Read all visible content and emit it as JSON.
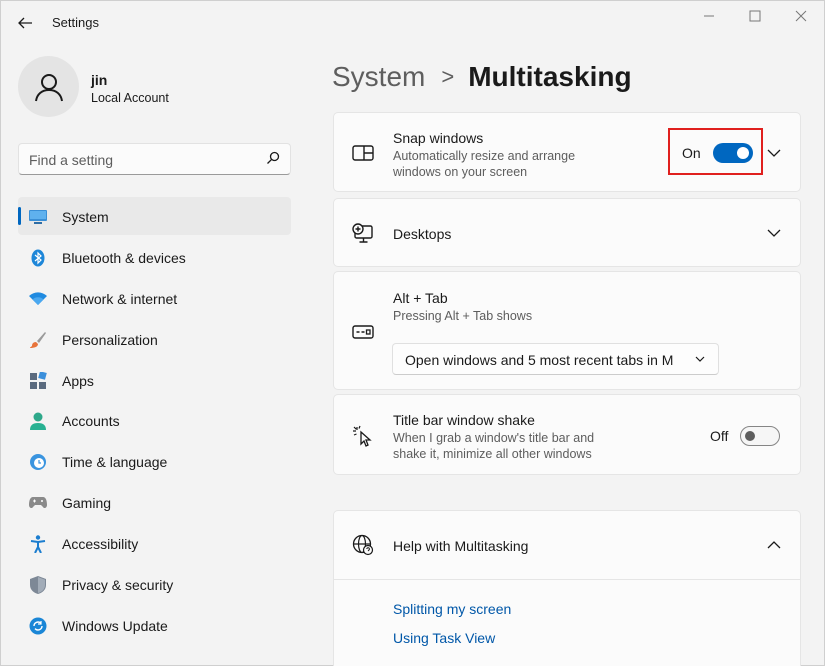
{
  "window": {
    "title": "Settings"
  },
  "profile": {
    "name": "jin",
    "account_type": "Local Account"
  },
  "search": {
    "placeholder": "Find a setting"
  },
  "sidebar": {
    "items": [
      {
        "label": "System",
        "icon": "monitor-icon",
        "active": true
      },
      {
        "label": "Bluetooth & devices",
        "icon": "bluetooth-icon"
      },
      {
        "label": "Network & internet",
        "icon": "wifi-icon"
      },
      {
        "label": "Personalization",
        "icon": "brush-icon"
      },
      {
        "label": "Apps",
        "icon": "apps-icon"
      },
      {
        "label": "Accounts",
        "icon": "person-icon"
      },
      {
        "label": "Time & language",
        "icon": "clock-globe-icon"
      },
      {
        "label": "Gaming",
        "icon": "gamepad-icon"
      },
      {
        "label": "Accessibility",
        "icon": "accessibility-icon"
      },
      {
        "label": "Privacy & security",
        "icon": "shield-icon"
      },
      {
        "label": "Windows Update",
        "icon": "update-icon"
      }
    ]
  },
  "breadcrumb": {
    "parent": "System",
    "separator": ">",
    "current": "Multitasking"
  },
  "cards": {
    "snap": {
      "title": "Snap windows",
      "description": "Automatically resize and arrange windows on your screen",
      "toggle_label": "On",
      "toggle_state": true
    },
    "desktops": {
      "title": "Desktops"
    },
    "alt_tab": {
      "title": "Alt + Tab",
      "description": "Pressing Alt + Tab shows",
      "dropdown_value": "Open windows and 5 most recent tabs in M"
    },
    "shake": {
      "title": "Title bar window shake",
      "description": "When I grab a window's title bar and shake it, minimize all other windows",
      "toggle_label": "Off",
      "toggle_state": false
    },
    "help": {
      "title": "Help with Multitasking",
      "links": [
        "Splitting my screen",
        "Using Task View"
      ]
    }
  },
  "colors": {
    "accent": "#0067c0",
    "highlight": "#e0201e",
    "link": "#0057a8"
  }
}
